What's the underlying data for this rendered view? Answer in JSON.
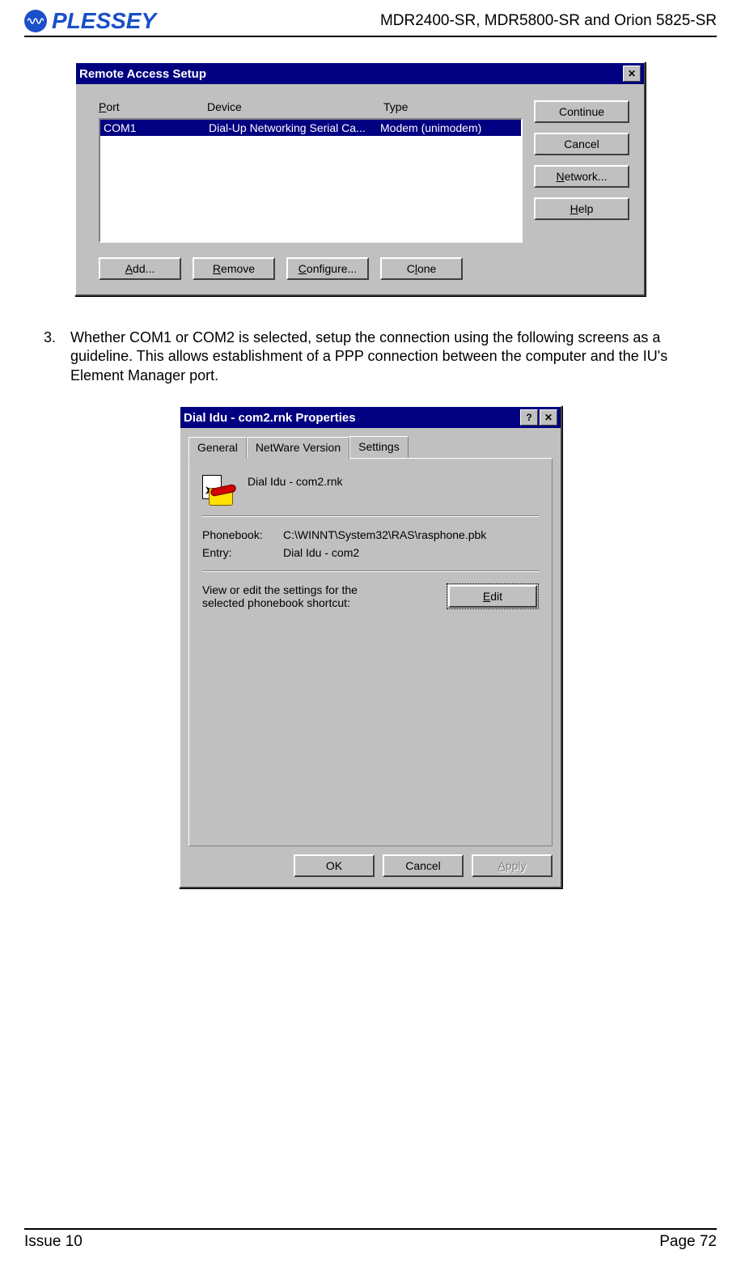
{
  "header": {
    "logo_text": "PLESSEY",
    "doc_title": "MDR2400-SR, MDR5800-SR and Orion 5825-SR"
  },
  "dialog1": {
    "title": "Remote Access Setup",
    "columns": {
      "c1": "Port",
      "c2": "Device",
      "c3": "Type"
    },
    "row": {
      "c1": "COM1",
      "c2": "Dial-Up Networking Serial Ca...",
      "c3": "Modem (unimodem)"
    },
    "buttons": {
      "continue": "Continue",
      "cancel": "Cancel",
      "network": "Network...",
      "help": "Help",
      "add": "Add...",
      "remove": "Remove",
      "configure": "Configure...",
      "clone": "Clone"
    }
  },
  "body": {
    "num": "3.",
    "text": "Whether COM1 or COM2 is selected, setup the connection using the following screens as a guideline.  This allows establishment of a PPP connection between the computer and the IU's Element Manager port."
  },
  "dialog2": {
    "title": "Dial Idu - com2.rnk Properties",
    "tabs": {
      "general": "General",
      "netware": "NetWare Version",
      "settings": "Settings"
    },
    "shortcut_name": "Dial Idu - com2.rnk",
    "phonebook_label": "Phonebook:",
    "phonebook_value": "C:\\WINNT\\System32\\RAS\\rasphone.pbk",
    "entry_label": "Entry:",
    "entry_value": "Dial Idu - com2",
    "edit_hint": "View or edit the settings for the selected phonebook shortcut:",
    "edit_btn": "Edit",
    "ok": "OK",
    "cancel": "Cancel",
    "apply": "Apply"
  },
  "footer": {
    "issue": "Issue 10",
    "page": "Page 72"
  }
}
